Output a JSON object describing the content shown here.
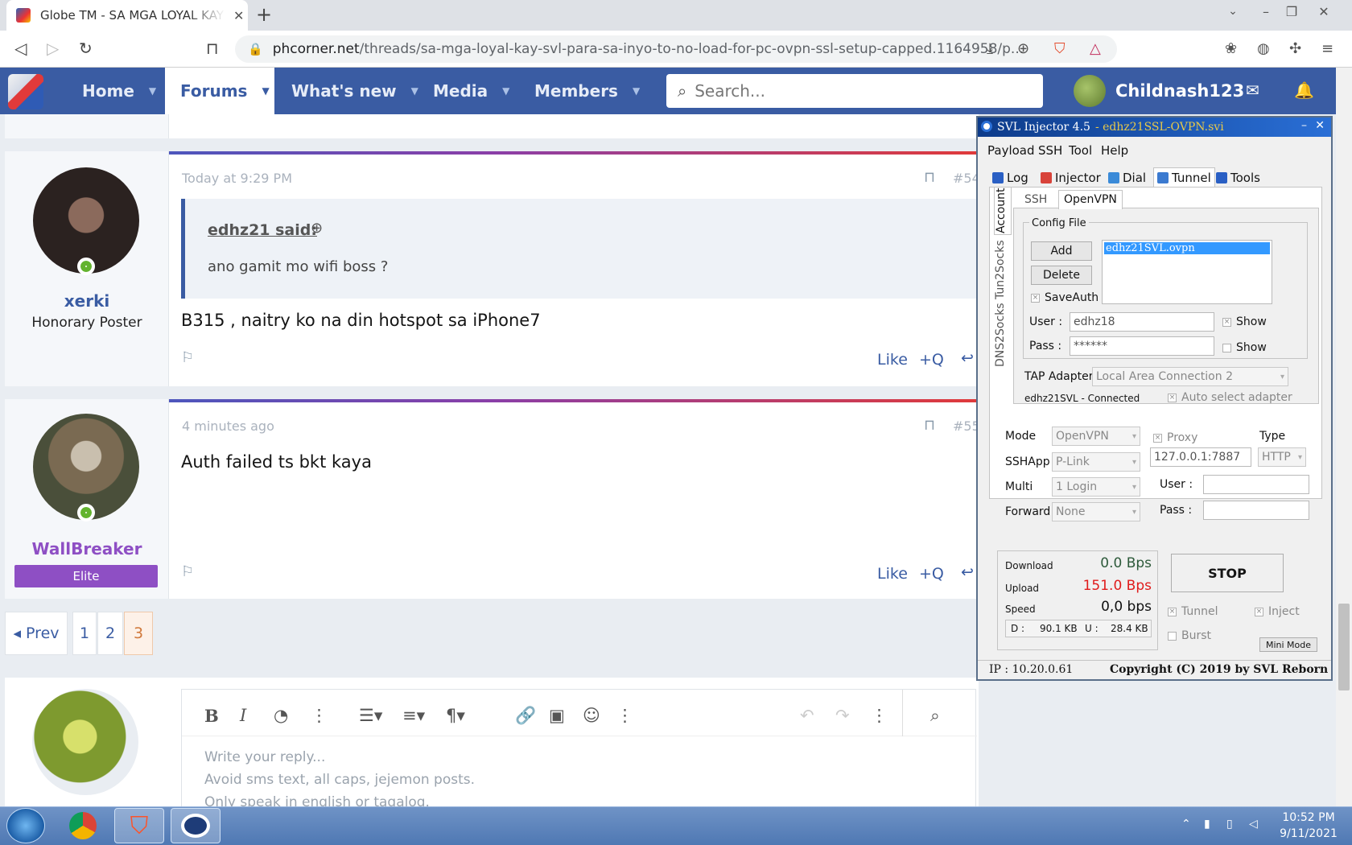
{
  "browser": {
    "tab_title": "Globe TM - SA MGA LOYAL KAY S",
    "url_host": "phcorner.net",
    "url_path": "/threads/sa-mga-loyal-kay-svl-para-sa-inyo-to-no-load-for-pc-ovpn-ssl-setup-capped.1164958/p..."
  },
  "forum_nav": {
    "items": [
      "Home",
      "Forums",
      "What's new",
      "Media",
      "Members"
    ],
    "search_placeholder": "Search...",
    "username": "Childnash123"
  },
  "posts": [
    {
      "user": "xerki",
      "title": "Honorary Poster",
      "date": "Today at 9:29 PM",
      "number": "#54",
      "quote_author": "edhz21 said:",
      "quote_text": "ano gamit mo wifi boss ?",
      "body": "B315 , naitry ko na din hotspot sa iPhone7",
      "like": "Like",
      "quote_btn": "+Q"
    },
    {
      "user": "WallBreaker",
      "title": "Elite",
      "date": "4 minutes ago",
      "number": "#55",
      "body": "Auth failed ts bkt kaya",
      "like": "Like",
      "quote_btn": "+Q"
    }
  ],
  "pagination": {
    "prev": "◂ Prev",
    "pages": [
      "1",
      "2",
      "3"
    ],
    "current": "3"
  },
  "editor": {
    "placeholder_lines": [
      "Write your reply...",
      "Avoid sms text, all caps, jejemon posts.",
      "Only speak in english or tagalog."
    ]
  },
  "svl": {
    "title": "SVL Injector 4.5",
    "subtitle": "- edhz21SSL-OVPN.svi",
    "menu": [
      "Payload",
      "SSH",
      "Tool",
      "Help"
    ],
    "tabs": [
      "Log",
      "Injector",
      "Dial",
      "Tunnel",
      "Tools"
    ],
    "side_tabs": [
      "Account",
      "Tun2Socks",
      "DNS2Socks"
    ],
    "inner_tabs": [
      "SSH",
      "OpenVPN"
    ],
    "config_label": "Config File",
    "add": "Add",
    "delete": "Delete",
    "config_item": "edhz21SVL.ovpn",
    "saveauth": "SaveAuth",
    "user_label": "User :",
    "user_value": "edhz18",
    "pass_label": "Pass :",
    "pass_value": "******",
    "show": "Show",
    "tap_label": "TAP Adapter",
    "tap_value": "Local Area Connection 2",
    "conn_status": "edhz21SVL - Connected",
    "auto_select": "Auto select adapter",
    "mode_label": "Mode",
    "mode_value": "OpenVPN",
    "sshapp_label": "SSHApp",
    "sshapp_value": "P-Link",
    "multi_label": "Multi",
    "multi_value": "1 Login",
    "forward_label": "Forward",
    "forward_value": "None",
    "proxy_label": "Proxy",
    "proxy_value": "127.0.0.1:7887",
    "type_label": "Type",
    "type_value": "HTTP",
    "puser_label": "User  :",
    "ppass_label": "Pass  :",
    "download_label": "Download",
    "download_value": "0.0 Bps",
    "upload_label": "Upload",
    "upload_value": "151.0 Bps",
    "speed_label": "Speed",
    "speed_value": "0,0 bps",
    "d_label": "D :",
    "d_value": "90.1 KB",
    "u_label": "U :",
    "u_value": "28.4 KB",
    "stop": "STOP",
    "tunnel": "Tunnel",
    "inject": "Inject",
    "burst": "Burst",
    "minimode": "Mini Mode",
    "ip": "IP : 10.20.0.61",
    "copyright": "Copyright (C) 2019 by SVL Reborn",
    "colors": {
      "upload": "#e01b1b",
      "titlebar": "#1c4fae"
    }
  },
  "taskbar": {
    "time": "10:52 PM",
    "date": "9/11/2021"
  }
}
